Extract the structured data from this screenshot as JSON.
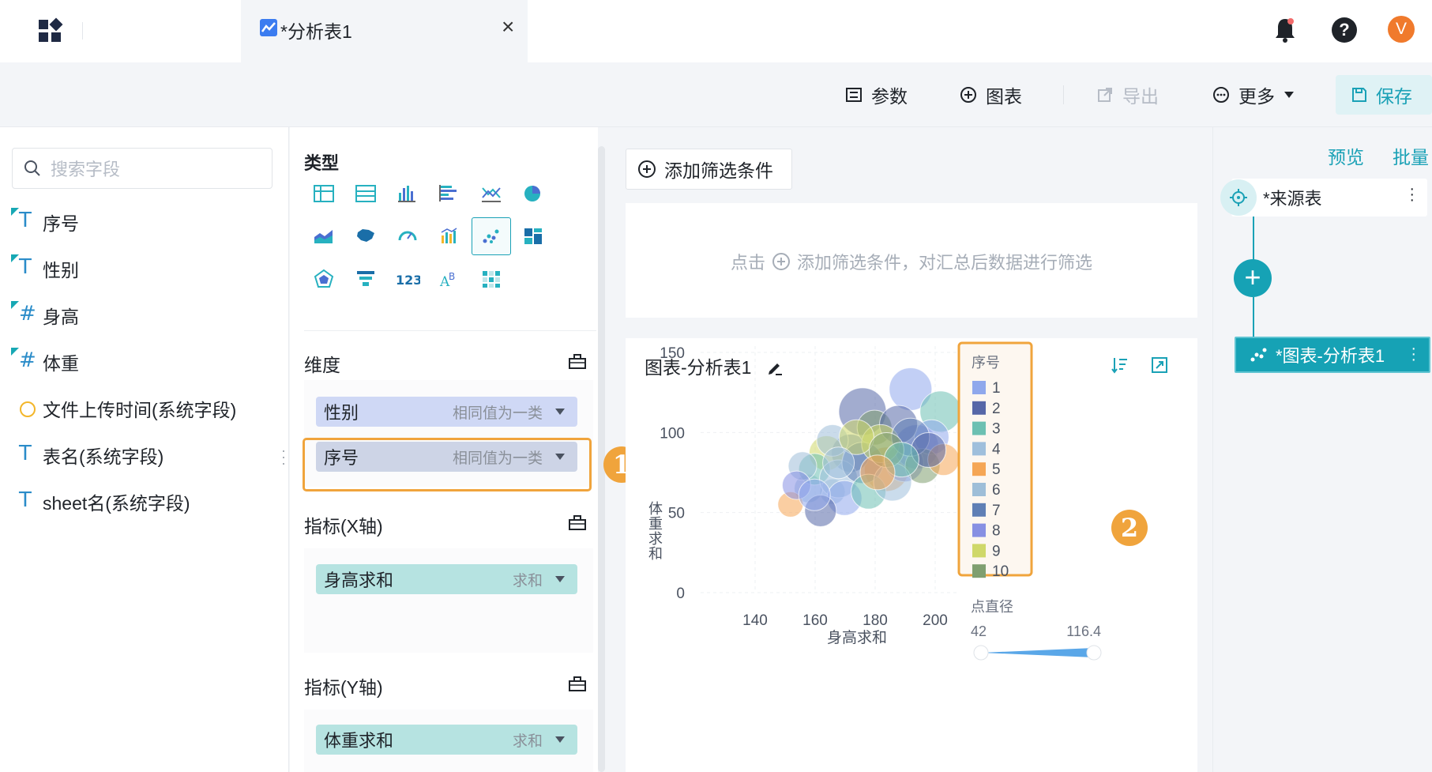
{
  "top": {
    "tab_title": "*分析表1",
    "tab_close": "×",
    "avatar_letter": "V",
    "help_glyph": "?"
  },
  "toolbar": {
    "params": "参数",
    "chart": "图表",
    "export": "导出",
    "more": "更多",
    "save": "保存"
  },
  "fields": {
    "search_placeholder": "搜索字段",
    "items": [
      "序号",
      "性别",
      "身高",
      "体重",
      "文件上传时间(系统字段)",
      "表名(系统字段)",
      "sheet名(系统字段)"
    ]
  },
  "config": {
    "type_title": "类型",
    "dim_title": "维度",
    "x_title": "指标(X轴)",
    "y_title": "指标(Y轴)",
    "dim_chips": [
      {
        "label": "性别",
        "mode": "相同值为一类"
      },
      {
        "label": "序号",
        "mode": "相同值为一类"
      }
    ],
    "x_chip": {
      "label": "身高求和",
      "mode": "求和"
    },
    "y_chip": {
      "label": "体重求和",
      "mode": "求和"
    },
    "badge1": "1",
    "badge2": "2"
  },
  "filter": {
    "button": "添加筛选条件",
    "hint_pre": "点击",
    "hint_post": "添加筛选条件，对汇总后数据进行筛选"
  },
  "chart_card": {
    "title": "图表-分析表1"
  },
  "chart_data": {
    "type": "scatter",
    "xlabel": "身高求和",
    "ylabel": "体重求和",
    "x_ticks": [
      "140",
      "160",
      "180",
      "200"
    ],
    "y_ticks": [
      "0",
      "50",
      "100",
      "150"
    ],
    "xlim": [
      130,
      205
    ],
    "ylim": [
      0,
      150
    ],
    "legend_title": "序号",
    "legend": [
      "1",
      "2",
      "3",
      "4",
      "5",
      "6",
      "7",
      "8",
      "9",
      "10"
    ],
    "legend_colors": [
      "#8fa8ec",
      "#5667a8",
      "#6cc0b2",
      "#9fbfdc",
      "#f5a655",
      "#9ebed8",
      "#5f7fb5",
      "#8790e3",
      "#cfd86a",
      "#7f9f70"
    ],
    "size_legend_title": "点直径",
    "size_min": "42",
    "size_max": "116.4",
    "points": [
      {
        "x": 186,
        "y": 132,
        "r": 27
      },
      {
        "x": 170,
        "y": 118,
        "r": 30
      },
      {
        "x": 196,
        "y": 118,
        "r": 26
      },
      {
        "x": 160,
        "y": 68,
        "r": 16
      },
      {
        "x": 178,
        "y": 82,
        "r": 28
      },
      {
        "x": 152,
        "y": 70,
        "r": 18
      },
      {
        "x": 166,
        "y": 92,
        "r": 24
      },
      {
        "x": 188,
        "y": 96,
        "r": 28
      },
      {
        "x": 158,
        "y": 92,
        "r": 22
      },
      {
        "x": 174,
        "y": 108,
        "r": 22
      },
      {
        "x": 193,
        "y": 102,
        "r": 22
      },
      {
        "x": 182,
        "y": 110,
        "r": 24
      },
      {
        "x": 154,
        "y": 82,
        "r": 20
      },
      {
        "x": 162,
        "y": 76,
        "r": 24
      },
      {
        "x": 146,
        "y": 60,
        "r": 16
      },
      {
        "x": 150,
        "y": 84,
        "r": 18
      },
      {
        "x": 170,
        "y": 86,
        "r": 26
      },
      {
        "x": 184,
        "y": 86,
        "r": 24
      },
      {
        "x": 176,
        "y": 98,
        "r": 24
      },
      {
        "x": 190,
        "y": 84,
        "r": 22
      },
      {
        "x": 164,
        "y": 64,
        "r": 22
      },
      {
        "x": 156,
        "y": 56,
        "r": 20
      },
      {
        "x": 172,
        "y": 68,
        "r": 22
      },
      {
        "x": 180,
        "y": 74,
        "r": 24
      },
      {
        "x": 197,
        "y": 88,
        "r": 20
      },
      {
        "x": 160,
        "y": 100,
        "r": 20
      },
      {
        "x": 186,
        "y": 102,
        "r": 24
      },
      {
        "x": 148,
        "y": 72,
        "r": 18
      },
      {
        "x": 168,
        "y": 102,
        "r": 22
      },
      {
        "x": 178,
        "y": 94,
        "r": 22
      },
      {
        "x": 154,
        "y": 66,
        "r": 20
      },
      {
        "x": 192,
        "y": 94,
        "r": 22
      },
      {
        "x": 183,
        "y": 88,
        "r": 22
      },
      {
        "x": 162,
        "y": 86,
        "r": 20
      },
      {
        "x": 175,
        "y": 80,
        "r": 22
      }
    ]
  }
}
